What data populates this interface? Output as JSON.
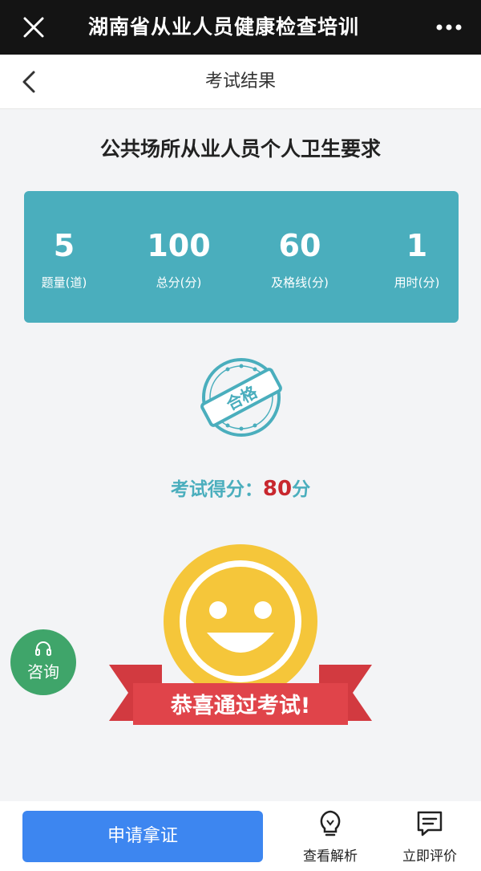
{
  "topbar": {
    "title": "湖南省从业人员健康检查培训",
    "close_icon": "close-icon",
    "more_icon": "more-dots-icon"
  },
  "navbar": {
    "title": "考试结果",
    "back_icon": "back-arrow-icon"
  },
  "exam": {
    "title": "公共场所从业人员个人卫生要求"
  },
  "stats": [
    {
      "value": "5",
      "label": "题量(道)"
    },
    {
      "value": "100",
      "label": "总分(分)"
    },
    {
      "value": "60",
      "label": "及格线(分)"
    },
    {
      "value": "1",
      "label": "用时(分)"
    }
  ],
  "result": {
    "stamp_text": "合格",
    "score_label": "考试得分：",
    "score_value": "80",
    "score_unit": "分"
  },
  "celebrate": {
    "text": "恭喜通过考试!"
  },
  "consult": {
    "label": "咨询"
  },
  "bottom": {
    "apply_label": "申请拿证",
    "analysis_label": "查看解析",
    "review_label": "立即评价"
  },
  "colors": {
    "accent": "#4aaebd",
    "score_red": "#c8272e",
    "button_blue": "#3d86f0",
    "consult_green": "#3fa56a",
    "ribbon_red": "#e0444a",
    "smiley_yellow": "#f5c63a"
  }
}
